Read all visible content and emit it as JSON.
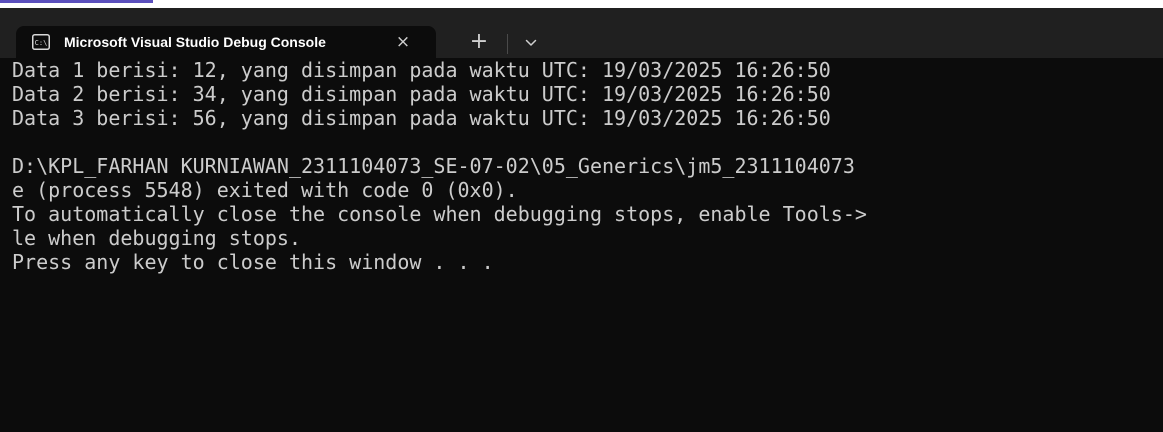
{
  "colors": {
    "accent_strip": "#5b4fbd",
    "titlebar_bg": "#202020",
    "console_bg": "#0c0c0c",
    "console_text": "#cccccc"
  },
  "tab": {
    "icon": "terminal-icon",
    "icon_text": "C:\\",
    "title": "Microsoft Visual Studio Debug Console",
    "close_label": "×"
  },
  "titlebar": {
    "new_tab_label": "+",
    "dropdown_icon": "chevron-down-icon"
  },
  "console": {
    "lines": [
      "Data 1 berisi: 12, yang disimpan pada waktu UTC: 19/03/2025 16:26:50",
      "Data 2 berisi: 34, yang disimpan pada waktu UTC: 19/03/2025 16:26:50",
      "Data 3 berisi: 56, yang disimpan pada waktu UTC: 19/03/2025 16:26:50",
      "",
      "D:\\KPL_FARHAN KURNIAWAN_2311104073_SE-07-02\\05_Generics\\jm5_2311104073",
      "e (process 5548) exited with code 0 (0x0).",
      "To automatically close the console when debugging stops, enable Tools->",
      "le when debugging stops.",
      "Press any key to close this window . . ."
    ]
  }
}
